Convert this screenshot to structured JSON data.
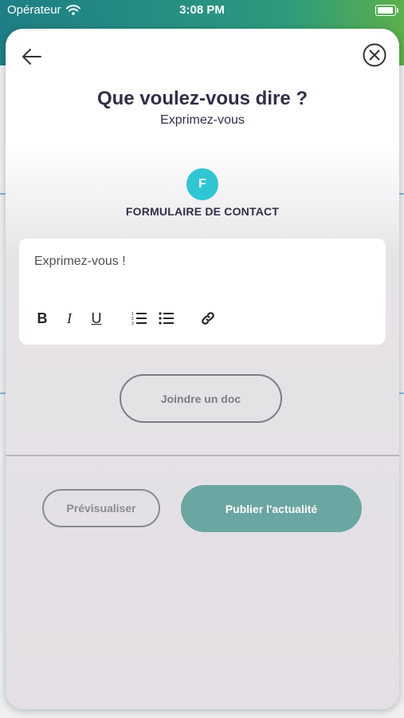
{
  "status_bar": {
    "carrier": "Opérateur",
    "time": "3:08 PM"
  },
  "modal": {
    "title": "Que voulez-vous dire ?",
    "subtitle": "Exprimez-vous",
    "avatar_letter": "F",
    "form_name": "FORMULAIRE DE CONTACT",
    "editor": {
      "placeholder": "Exprimez-vous !",
      "toolbar": {
        "bold": "B",
        "italic": "I",
        "underline": "U"
      }
    },
    "attach_label": "Joindre un doc",
    "preview_label": "Prévisualiser",
    "publish_label": "Publier l'actualité"
  },
  "colors": {
    "accent": "#2ec6d3",
    "publish": "#6aa6a2",
    "title": "#2f3047"
  }
}
